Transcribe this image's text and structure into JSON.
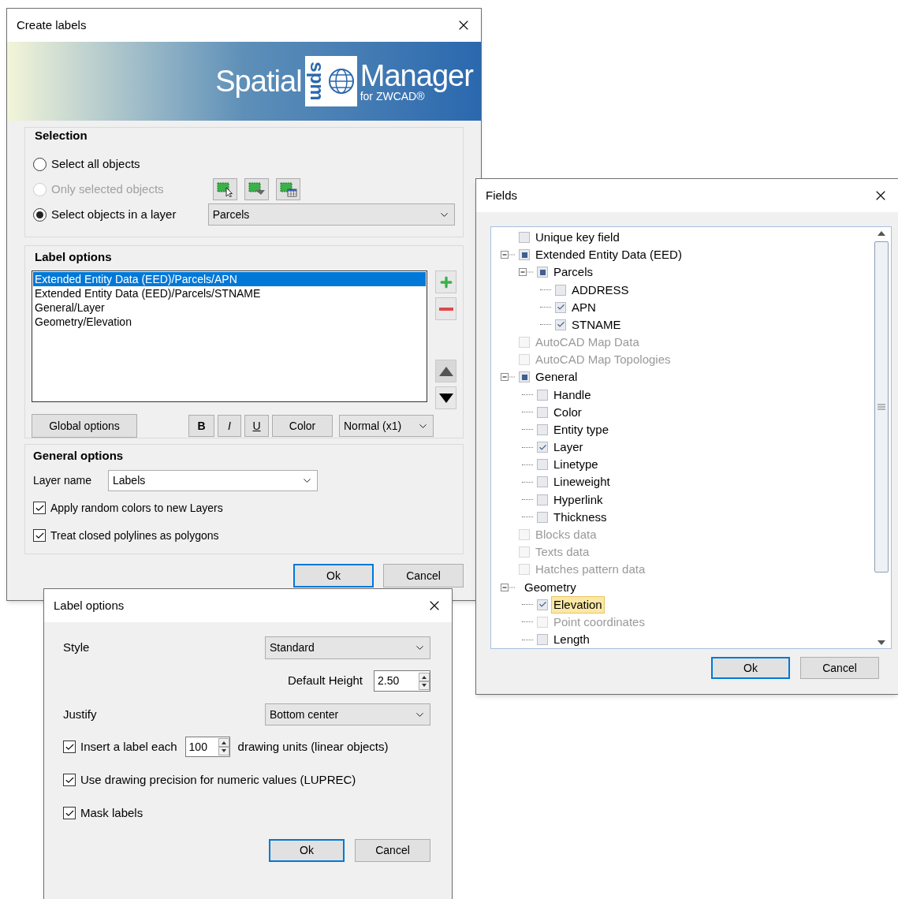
{
  "create_labels": {
    "title": "Create labels",
    "logo": {
      "left": "Spatial",
      "mark": "spm",
      "right": "Manager",
      "sub": "for ZWCAD®"
    },
    "selection": {
      "heading": "Selection",
      "options": [
        {
          "label": "Select all objects",
          "selected": false,
          "disabled": false
        },
        {
          "label": "Only selected objects",
          "selected": false,
          "disabled": true
        },
        {
          "label": "Select objects in a layer",
          "selected": true,
          "disabled": false
        }
      ],
      "layer": {
        "value": "Parcels"
      }
    },
    "label_options": {
      "heading": "Label options",
      "items": [
        {
          "label": "Extended Entity Data (EED)/Parcels/APN",
          "selected": true
        },
        {
          "label": "Extended Entity Data (EED)/Parcels/STNAME",
          "selected": false
        },
        {
          "label": "General/Layer",
          "selected": false
        },
        {
          "label": "Geometry/Elevation",
          "selected": false
        }
      ],
      "global_button": "Global options",
      "bold": "B",
      "italic": "I",
      "underline": "U",
      "color_button": "Color",
      "size": {
        "value": "Normal (x1)"
      }
    },
    "general_options": {
      "heading": "General options",
      "layer_label": "Layer name",
      "layer": {
        "value": "Labels"
      },
      "checks": [
        {
          "label": "Apply random colors to new Layers",
          "checked": true
        },
        {
          "label": "Treat closed polylines as polygons",
          "checked": true
        }
      ]
    },
    "buttons": [
      {
        "label": "Ok",
        "default": true
      },
      {
        "label": "Cancel",
        "default": false
      }
    ]
  },
  "fields": {
    "title": "Fields",
    "tree": [
      {
        "label": "Unique key field",
        "checked": false,
        "disabled": false,
        "selected": false
      },
      {
        "label": "Extended Entity Data (EED)",
        "partial": true,
        "disabled": false,
        "selected": false,
        "expanded": true,
        "children": [
          {
            "label": "Parcels",
            "partial": true,
            "disabled": false,
            "selected": false,
            "expanded": true,
            "children": [
              {
                "label": "ADDRESS",
                "checked": false,
                "disabled": false,
                "selected": false
              },
              {
                "label": "APN",
                "checked": true,
                "disabled": false,
                "selected": false
              },
              {
                "label": "STNAME",
                "checked": true,
                "disabled": false,
                "selected": false
              }
            ]
          }
        ]
      },
      {
        "label": "AutoCAD Map Data",
        "checked": false,
        "disabled": true,
        "selected": false
      },
      {
        "label": "AutoCAD Map Topologies",
        "checked": false,
        "disabled": true,
        "selected": false
      },
      {
        "label": "General",
        "partial": true,
        "disabled": false,
        "selected": false,
        "expanded": true,
        "children": [
          {
            "label": "Handle",
            "checked": false,
            "disabled": false,
            "selected": false
          },
          {
            "label": "Color",
            "checked": false,
            "disabled": false,
            "selected": false
          },
          {
            "label": "Entity type",
            "checked": false,
            "disabled": false,
            "selected": false
          },
          {
            "label": "Layer",
            "checked": true,
            "disabled": false,
            "selected": false
          },
          {
            "label": "Linetype",
            "checked": false,
            "disabled": false,
            "selected": false
          },
          {
            "label": "Lineweight",
            "checked": false,
            "disabled": false,
            "selected": false
          },
          {
            "label": "Hyperlink",
            "checked": false,
            "disabled": false,
            "selected": false
          },
          {
            "label": "Thickness",
            "checked": false,
            "disabled": false,
            "selected": false
          }
        ]
      },
      {
        "label": "Blocks data",
        "checked": false,
        "disabled": true,
        "selected": false
      },
      {
        "label": "Texts data",
        "checked": false,
        "disabled": true,
        "selected": false
      },
      {
        "label": "Hatches pattern data",
        "checked": false,
        "disabled": true,
        "selected": false
      },
      {
        "label": "Geometry",
        "expanded": true,
        "disabled": false,
        "selected": false,
        "children": [
          {
            "label": "Elevation",
            "checked": true,
            "disabled": false,
            "selected": true
          },
          {
            "label": "Point coordinates",
            "checked": false,
            "disabled": true,
            "selected": false
          },
          {
            "label": "Length",
            "checked": false,
            "disabled": false,
            "selected": false
          }
        ]
      }
    ],
    "buttons": [
      {
        "label": "Ok",
        "default": true
      },
      {
        "label": "Cancel",
        "default": false
      }
    ]
  },
  "label_options_dialog": {
    "title": "Label options",
    "style_label": "Style",
    "style": {
      "value": "Standard"
    },
    "height_label": "Default Height",
    "height": {
      "value": "2.50"
    },
    "justify_label": "Justify",
    "justify": {
      "value": "Bottom center"
    },
    "checks": [
      {
        "kind": "spinner",
        "label": "Insert a label each",
        "checked": true,
        "value": "100",
        "suffix": "drawing units (linear objects)"
      },
      {
        "kind": "plain",
        "label": "Use drawing precision for numeric values (LUPREC)",
        "checked": true
      },
      {
        "kind": "plain",
        "label": "Mask labels",
        "checked": true
      }
    ],
    "buttons": [
      {
        "label": "Ok",
        "default": true
      },
      {
        "label": "Cancel",
        "default": false
      }
    ]
  }
}
